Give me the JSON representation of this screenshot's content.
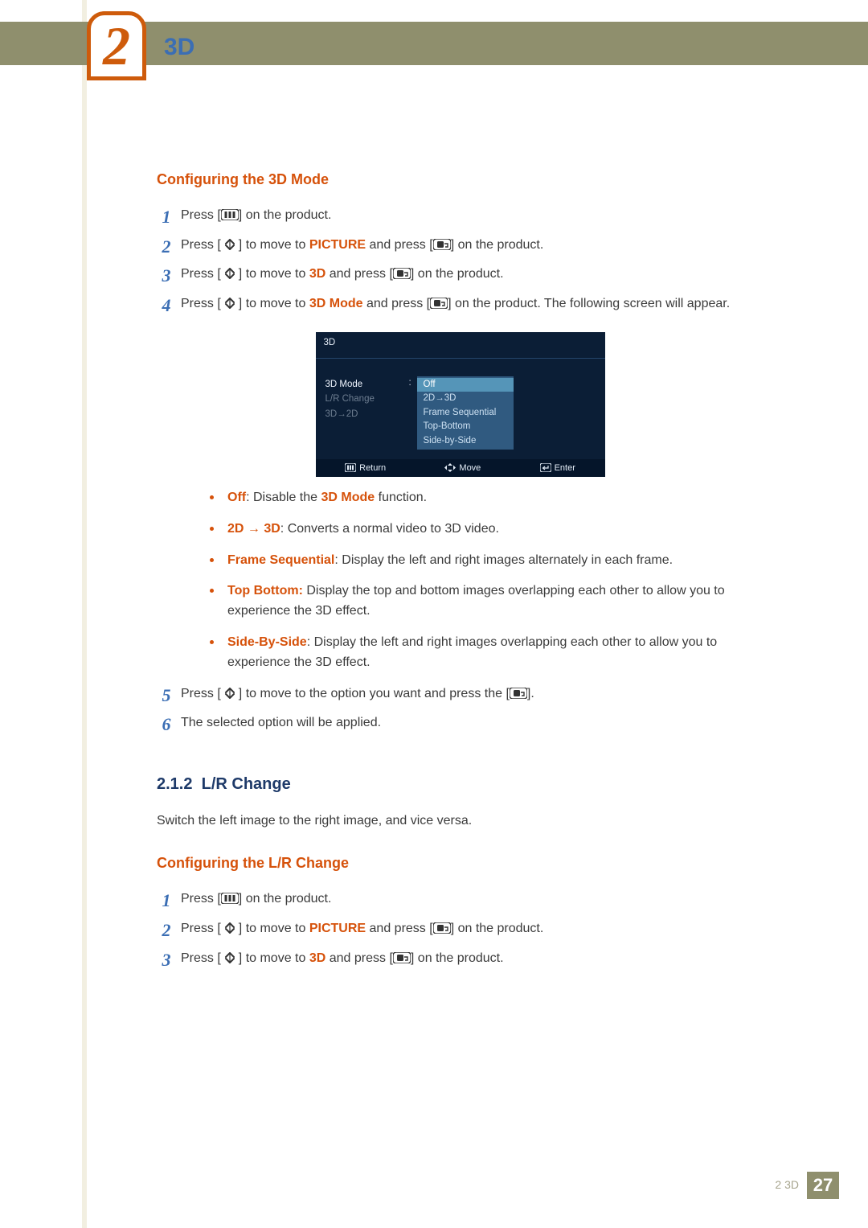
{
  "chapter_number": "2",
  "chapter_title": "3D",
  "sections": {
    "config3d": {
      "heading": "Configuring the 3D Mode",
      "steps": {
        "s1": {
          "pre": "Press [",
          "post": "] on the product."
        },
        "s2": {
          "a": "Press [",
          "b": "] to move to ",
          "kw": "PICTURE",
          "c": " and press [",
          "d": "] on the product."
        },
        "s3": {
          "a": "Press [",
          "b": "] to move to ",
          "kw": "3D",
          "c": " and press [",
          "d": "] on the product."
        },
        "s4": {
          "a": "Press [",
          "b": "] to move to ",
          "kw": "3D Mode",
          "c": " and press [",
          "d": "] on the product. The following screen will appear."
        },
        "s5": {
          "a": "Press [",
          "b": "] to move to the option you want and press the [",
          "c": "]."
        },
        "s6": "The selected option will be applied."
      },
      "bullets": {
        "off": {
          "term": "Off",
          "rest": ": Disable the ",
          "kw": "3D Mode",
          "tail": " function."
        },
        "2d3d": {
          "term": "2D → 3D",
          "rest": ": Converts a normal video to 3D video."
        },
        "fs": {
          "term": "Frame Sequential",
          "rest": ": Display the left and right images alternately in each frame."
        },
        "tb": {
          "term": "Top Bottom:",
          "rest": " Display the top and bottom images overlapping each other to allow you to experience the 3D effect."
        },
        "sbs": {
          "term": "Side-By-Side",
          "rest": ": Display the left and right images overlapping each other to allow you to experience the 3D effect."
        }
      }
    },
    "lr": {
      "number": "2.1.2",
      "title": "L/R Change",
      "intro": "Switch the left image to the right image, and vice versa.",
      "config_heading": "Configuring the L/R Change",
      "steps": {
        "s1": {
          "pre": "Press [",
          "post": "] on the product."
        },
        "s2": {
          "a": "Press [",
          "b": "] to move to ",
          "kw": "PICTURE",
          "c": " and press [",
          "d": "] on the product."
        },
        "s3": {
          "a": "Press [",
          "b": "] to move to ",
          "kw": "3D",
          "c": " and press [",
          "d": "] on the product."
        }
      }
    }
  },
  "osd": {
    "title": "3D",
    "labels": {
      "mode": "3D Mode",
      "lr": "L/R Change",
      "to2d": "3D→2D"
    },
    "options": {
      "off": "Off",
      "to3d": "2D→3D",
      "fs": "Frame Sequential",
      "tb": "Top-Bottom",
      "sbs": "Side-by-Side"
    },
    "footer": {
      "return": "Return",
      "move": "Move",
      "enter": "Enter"
    }
  },
  "footer": {
    "crumb": "2 3D",
    "page": "27"
  }
}
